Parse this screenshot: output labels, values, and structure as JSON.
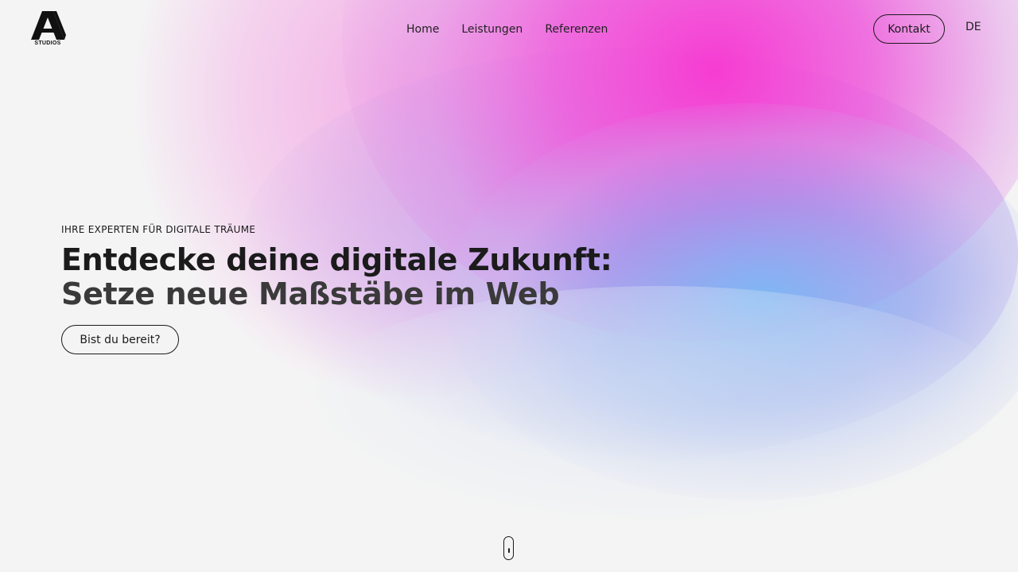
{
  "brand": {
    "logo_text": "STUDIOS"
  },
  "nav": {
    "items": [
      {
        "label": "Home"
      },
      {
        "label": "Leistungen"
      },
      {
        "label": "Referenzen"
      }
    ]
  },
  "header": {
    "contact_label": "Kontakt",
    "language": "DE"
  },
  "hero": {
    "eyebrow": "IHRE EXPERTEN FÜR DIGITALE TRÄUME",
    "headline_line1": "Entdecke deine digitale Zukunft:",
    "headline_line2": "Setze neue Maßstäbe im Web",
    "cta_label": "Bist du bereit?"
  },
  "colors": {
    "background": "#f4f4f4",
    "text": "#1a1a1a",
    "gradient_magenta": "#f63cd2",
    "gradient_purple": "#aa82eb",
    "gradient_blue": "#78b9f5"
  },
  "icons": {
    "logo": "a-studios-logo",
    "scroll": "mouse-scroll-icon"
  }
}
